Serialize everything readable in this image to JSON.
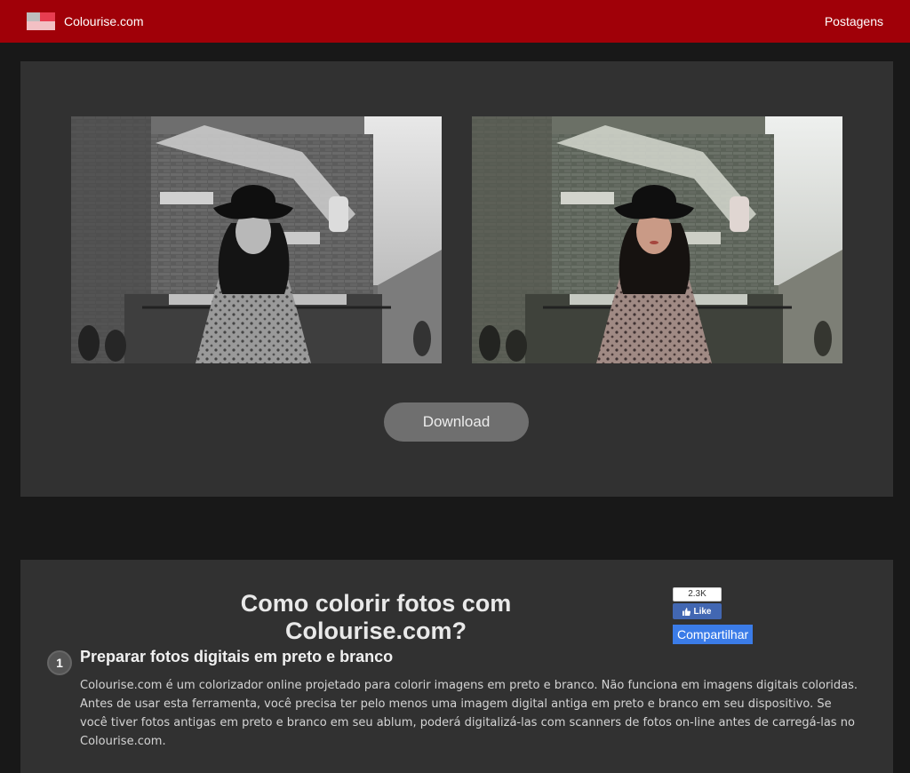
{
  "header": {
    "brand": "Colourise.com",
    "nav_link": "Postagens",
    "bg_color": "#a00008"
  },
  "preview": {
    "download_label": "Download"
  },
  "guide": {
    "title": "Como colorir fotos com Colourise.com?",
    "like_count": "2.3K",
    "like_label": "Like",
    "share_label": "Compartilhar",
    "step_number": "1",
    "step_title": "Preparar fotos digitais em preto e branco",
    "step_text": "Colourise.com é um colorizador online projetado para colorir imagens em preto e branco. Não funciona em imagens digitais coloridas. Antes de usar esta ferramenta, você precisa ter pelo menos uma imagem digital antiga em preto e branco em seu dispositivo. Se você tiver fotos antigas em preto e branco em seu ablum, poderá digitalizá-las com scanners de fotos on-line antes de carregá-las no Colourise.com."
  }
}
